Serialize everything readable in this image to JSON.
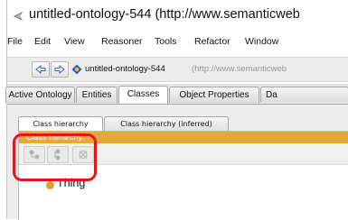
{
  "window": {
    "title": "untitled-ontology-544 (http://www.semanticweb",
    "icon": "protege-app-icon"
  },
  "menubar": {
    "items": [
      "File",
      "Edit",
      "View",
      "Reasoner",
      "Tools",
      "Refactor",
      "Window"
    ]
  },
  "navbar": {
    "back_icon": "back-arrow-icon",
    "forward_icon": "forward-arrow-icon",
    "ontology_icon": "ontology-diamond-icon",
    "ontology_name": "untitled-ontology-544",
    "ontology_url": "(http://www.semanticweb"
  },
  "tabs": {
    "items": [
      "Active Ontology",
      "Entities",
      "Classes",
      "Object Properties",
      "Da"
    ],
    "active": "Classes"
  },
  "subtabs": {
    "items": [
      "Class hierarchy",
      "Class hierarchy (inferred)"
    ],
    "active": "Class hierarchy"
  },
  "class_view": {
    "title": "Class hierarchy:",
    "toolbar_icons": [
      "add-subclass-icon",
      "add-sibling-class-icon",
      "delete-class-icon"
    ],
    "tree": [
      {
        "label": "Thing",
        "icon": "class-dot-icon",
        "color": "#e8a020"
      }
    ]
  },
  "colors": {
    "view_header": "#e6a832",
    "highlight_annotation": "#e01818"
  }
}
